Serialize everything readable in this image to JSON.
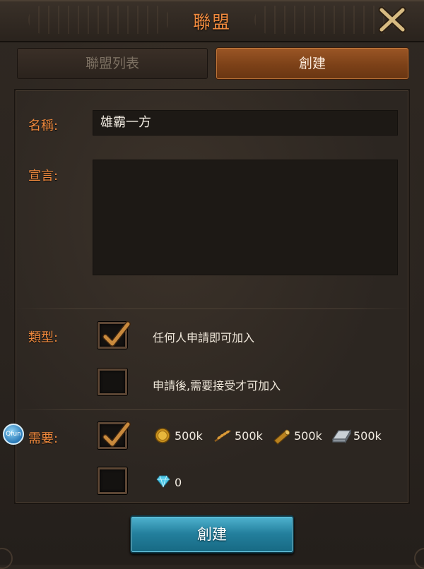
{
  "header": {
    "title": "聯盟"
  },
  "tabs": [
    {
      "label": "聯盟列表",
      "active": false
    },
    {
      "label": "創建",
      "active": true
    }
  ],
  "form": {
    "name_label": "名稱:",
    "name_value": "雄霸一方",
    "declaration_label": "宣言:",
    "declaration_value": "",
    "type_label": "類型:",
    "type_options": [
      {
        "text": "任何人申請即可加入",
        "checked": true
      },
      {
        "text": "申請後,需要接受才可加入",
        "checked": false
      }
    ],
    "requirement_label": "需要:",
    "requirement_options": [
      {
        "checked": true,
        "costs": [
          {
            "icon": "gold-coin-icon",
            "value": "500k"
          },
          {
            "icon": "wheat-food-icon",
            "value": "500k"
          },
          {
            "icon": "wood-log-icon",
            "value": "500k"
          },
          {
            "icon": "iron-ingot-icon",
            "value": "500k"
          }
        ]
      },
      {
        "checked": false,
        "costs": [
          {
            "icon": "diamond-gem-icon",
            "value": "0"
          }
        ]
      }
    ]
  },
  "create_button": "創建",
  "side_badge": "Qfun",
  "colors": {
    "accent": "#f08a3e",
    "tab_active": "#7c4118",
    "button": "#237f9d"
  }
}
